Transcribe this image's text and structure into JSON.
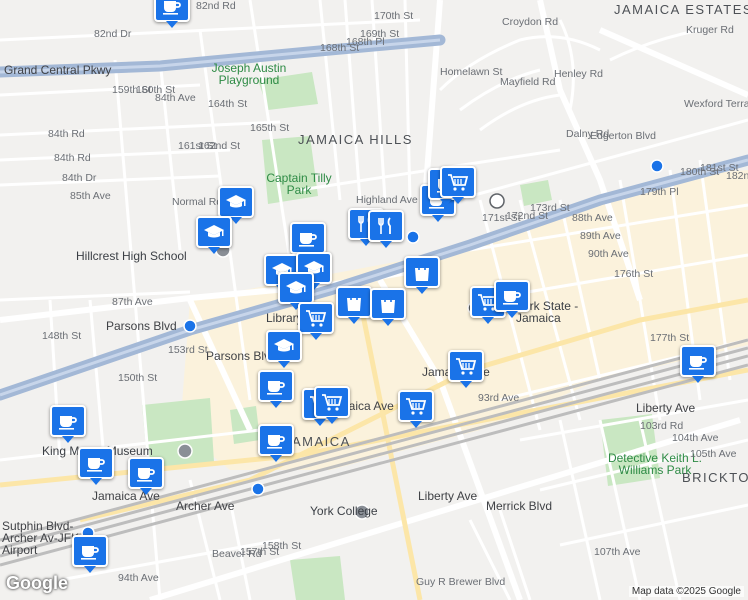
{
  "map": {
    "attribution": "Map data ©2025 Google",
    "logo": "Google",
    "labels": {
      "neighborhoods": [
        "JAMAICA ESTATES",
        "JAMAICA HILLS",
        "JAMAICA",
        "BRICKTOWN"
      ],
      "parks": [
        "Joseph Austin Playground",
        "Captain Tilly Park",
        "Detective Keith L. Williams Park"
      ],
      "pois": [
        "Hillcrest High School",
        "King Manor Museum",
        "York College",
        "York State - Jamaica",
        "Library"
      ],
      "stations": [
        "Parsons Blvd",
        "Jamaica Ave",
        "Jamaica",
        "Sutphin Blvd-Archer Av-JFK Airport"
      ],
      "roads": [
        "82nd Rd",
        "82nd Dr",
        "Grand Central Pkwy",
        "84th Ave",
        "84th Rd",
        "84th Dr",
        "85th Ave",
        "87th Ave",
        "88th Ave",
        "89th Ave",
        "90th Ave",
        "93rd Ave",
        "94th Ave",
        "Highland Ave",
        "Croydon Rd",
        "Kruger Rd",
        "Mayfield Rd",
        "Henley Rd",
        "Wexford Terrace",
        "Homelawn St",
        "Edgerton Blvd",
        "Dalny Rd",
        "Jamaica Ave",
        "Liberty Ave",
        "Archer Ave",
        "Merrick Blvd",
        "Guy R Brewer Blvd",
        "103rd Rd",
        "104th Ave",
        "105th Ave",
        "107th Ave",
        "Parsons Blvd",
        "Normal Rd",
        "Beaver Rd",
        "148th St",
        "150th St",
        "153rd St",
        "157th St",
        "158th St",
        "159th St",
        "160th St",
        "161st St",
        "162nd St",
        "164th St",
        "165th St",
        "168th St",
        "168th Pl",
        "169th St",
        "170th St",
        "171st St",
        "172nd St",
        "173rd St",
        "176th St",
        "177th St",
        "179th Pl",
        "180th St",
        "181st St",
        "182nd St"
      ]
    },
    "markers": [
      {
        "type": "cafe"
      },
      {
        "type": "cafe"
      },
      {
        "type": "school"
      },
      {
        "type": "school"
      },
      {
        "type": "cafe"
      },
      {
        "type": "cafe"
      },
      {
        "type": "restaurant"
      },
      {
        "type": "restaurant"
      },
      {
        "type": "school"
      },
      {
        "type": "school"
      },
      {
        "type": "school"
      },
      {
        "type": "shop"
      },
      {
        "type": "grocery"
      },
      {
        "type": "shop"
      },
      {
        "type": "shop"
      },
      {
        "type": "grocery"
      },
      {
        "type": "cafe"
      },
      {
        "type": "school"
      },
      {
        "type": "cafe"
      },
      {
        "type": "grocery"
      },
      {
        "type": "grocery"
      },
      {
        "type": "grocery"
      },
      {
        "type": "grocery"
      },
      {
        "type": "cafe"
      },
      {
        "type": "cafe"
      },
      {
        "type": "cafe"
      },
      {
        "type": "cafe"
      },
      {
        "type": "cafe"
      },
      {
        "type": "cafe"
      },
      {
        "type": "grocery"
      }
    ]
  }
}
